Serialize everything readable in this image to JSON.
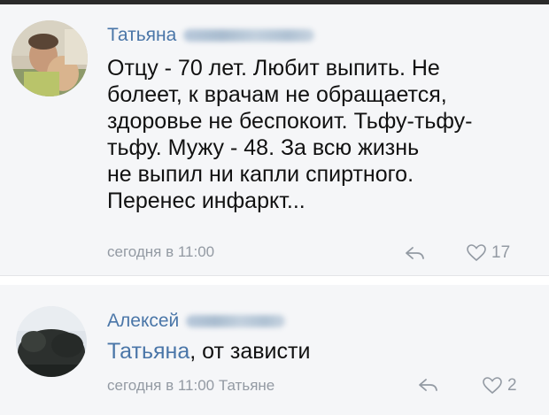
{
  "colors": {
    "link": "#4a76a8",
    "meta": "#939aa3",
    "background": "#f5f6f8"
  },
  "comments": [
    {
      "author": "Татьяна",
      "text_lines": [
        "Отцу - 70 лет. Любит выпить. Не",
        "болеет, к врачам не обращается,",
        "здоровье не беспокоит. Тьфу-тьфу-",
        "тьфу. Мужу - 48. За всю жизнь",
        "не выпил ни капли спиртного.",
        "Перенес инфаркт..."
      ],
      "timestamp": "сегодня в 11:00",
      "likes": "17",
      "reply_icon": "reply-arrow-icon",
      "like_icon": "heart-icon"
    },
    {
      "author": "Алексей",
      "mention": "Татьяна",
      "text": ", от зависти",
      "timestamp": "сегодня в 11:00 Татьяне",
      "likes": "2",
      "reply_icon": "reply-arrow-icon",
      "like_icon": "heart-icon"
    }
  ]
}
